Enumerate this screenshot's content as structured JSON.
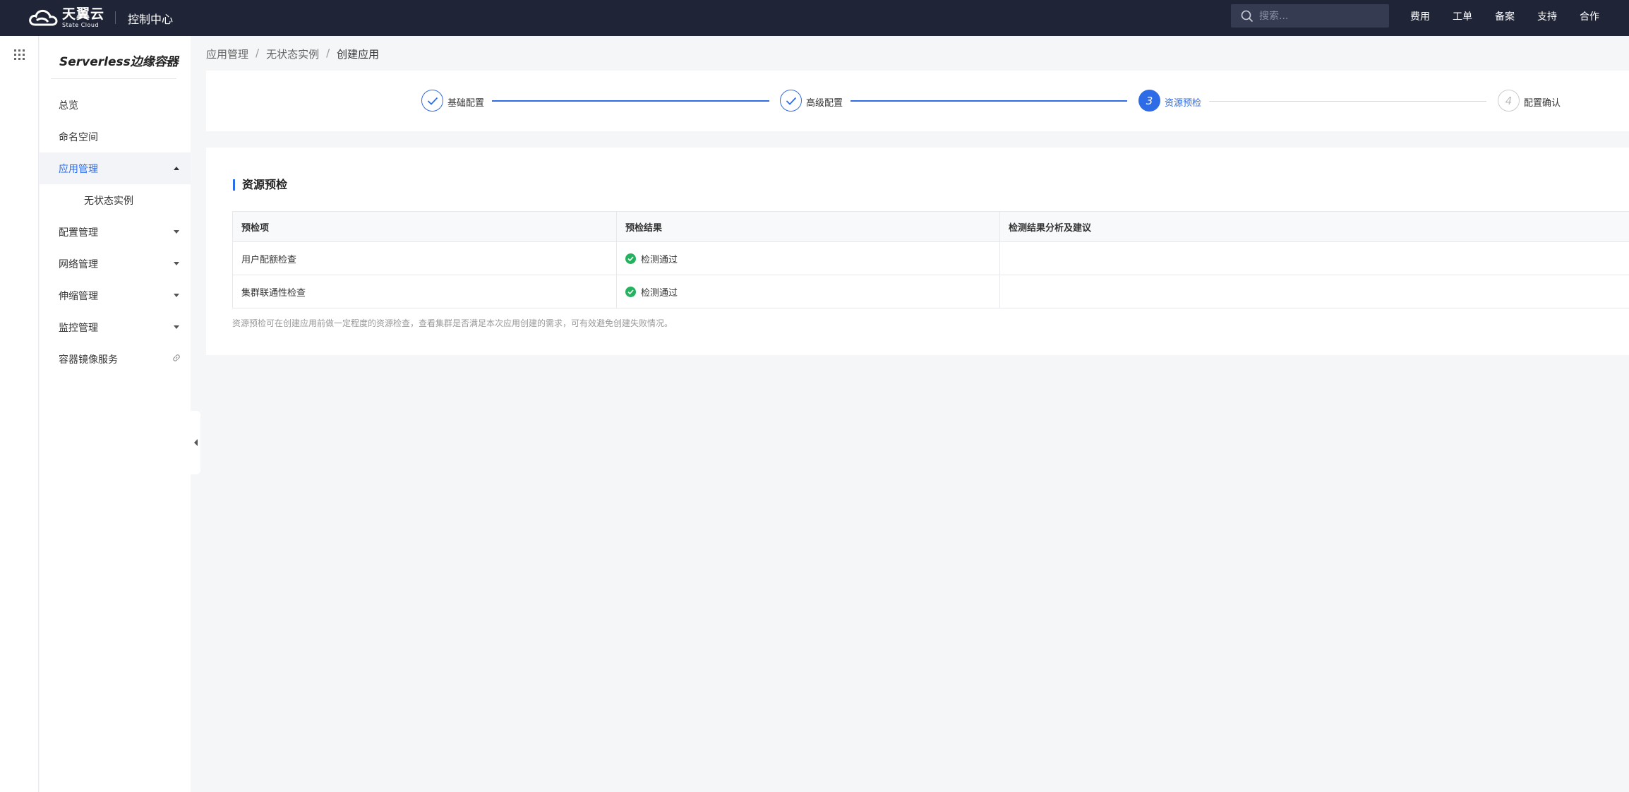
{
  "topbar": {
    "logo_cn": "天翼云",
    "logo_en": "State Cloud",
    "title": "控制中心",
    "search_placeholder": "搜索...",
    "links": [
      "费用",
      "工单",
      "备案",
      "支持",
      "合作"
    ]
  },
  "sidebar": {
    "title": "Serverless边缘容器",
    "items": [
      {
        "label": "总览"
      },
      {
        "label": "命名空间"
      },
      {
        "label": "应用管理"
      },
      {
        "label": "无状态实例"
      },
      {
        "label": "配置管理"
      },
      {
        "label": "网络管理"
      },
      {
        "label": "伸缩管理"
      },
      {
        "label": "监控管理"
      },
      {
        "label": "容器镜像服务"
      }
    ]
  },
  "breadcrumb": [
    "应用管理",
    "无状态实例",
    "创建应用"
  ],
  "steps": [
    {
      "label": "基础配置",
      "status": "done"
    },
    {
      "label": "高级配置",
      "status": "done"
    },
    {
      "label": "资源预检",
      "status": "current",
      "number": "3"
    },
    {
      "label": "配置确认",
      "status": "todo",
      "number": "4"
    }
  ],
  "section": {
    "title": "资源预检",
    "columns": [
      "预检项",
      "预检结果",
      "检测结果分析及建议"
    ],
    "rows": [
      {
        "item": "用户配额检查",
        "result": "检测通过",
        "advice": ""
      },
      {
        "item": "集群联通性检查",
        "result": "检测通过",
        "advice": ""
      }
    ],
    "note": "资源预检可在创建应用前做一定程度的资源检查，查看集群是否满足本次应用创建的需求，可有效避免创建失败情况。"
  },
  "colors": {
    "accent": "#2e6be6",
    "success": "#23b35e",
    "topbar_bg": "#1f2537"
  }
}
